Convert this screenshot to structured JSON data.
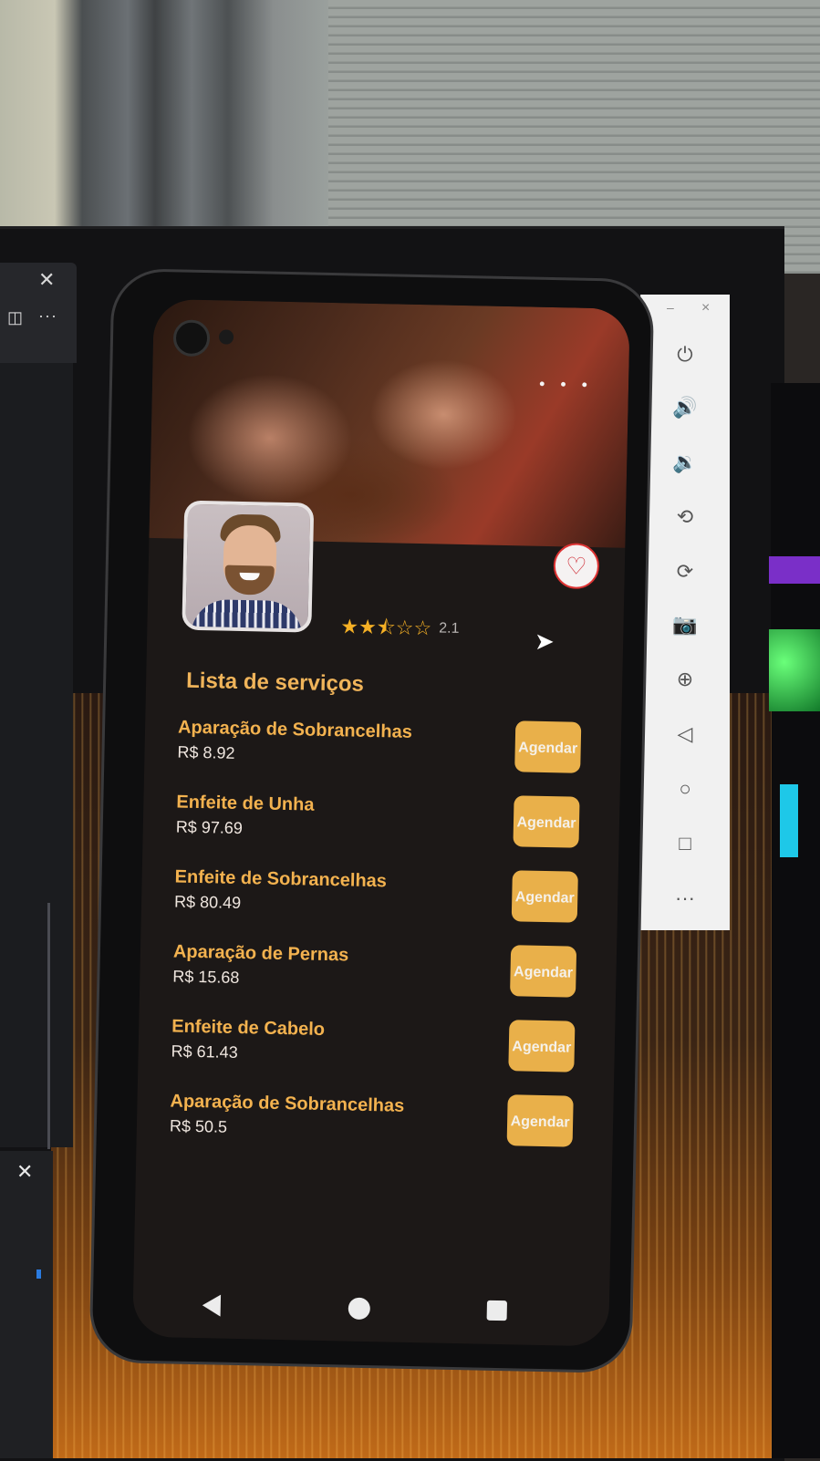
{
  "desktop": {
    "left_panel": {
      "close_icon": "✕",
      "more_icon": "···"
    },
    "left_panel_2": {
      "close_icon": "✕"
    }
  },
  "emulator_toolbar": {
    "minimize_icon": "–",
    "close_icon": "×",
    "tools": [
      {
        "name": "power-icon",
        "glyph": "⏻"
      },
      {
        "name": "volume-up-icon",
        "glyph": "🔊"
      },
      {
        "name": "volume-down-icon",
        "glyph": "🔉"
      },
      {
        "name": "rotate-left-icon",
        "glyph": "⟲"
      },
      {
        "name": "rotate-right-icon",
        "glyph": "⟳"
      },
      {
        "name": "camera-icon",
        "glyph": "📷"
      },
      {
        "name": "zoom-icon",
        "glyph": "⊕"
      },
      {
        "name": "back-icon",
        "glyph": "◁"
      },
      {
        "name": "home-icon",
        "glyph": "○"
      },
      {
        "name": "overview-icon",
        "glyph": "□"
      },
      {
        "name": "more-icon",
        "glyph": "···"
      }
    ]
  },
  "app": {
    "hero": {
      "menu_dots": "• • •"
    },
    "favorite_icon": "♡",
    "rating": {
      "value": "2.1",
      "stars_filled": 2.5,
      "stars_total": 5
    },
    "section_title": "Lista de serviços",
    "services": [
      {
        "name": "Aparação de Sobrancelhas",
        "price": "R$ 8.92",
        "button": "Agendar"
      },
      {
        "name": "Enfeite de Unha",
        "price": "R$ 97.69",
        "button": "Agendar"
      },
      {
        "name": "Enfeite de Sobrancelhas",
        "price": "R$ 80.49",
        "button": "Agendar"
      },
      {
        "name": "Aparação de Pernas",
        "price": "R$ 15.68",
        "button": "Agendar"
      },
      {
        "name": "Enfeite de Cabelo",
        "price": "R$ 61.43",
        "button": "Agendar"
      },
      {
        "name": "Aparação de Sobrancelhas",
        "price": "R$ 50.5",
        "button": "Agendar"
      }
    ]
  },
  "colors": {
    "accent": "#f3b24f",
    "button_bg": "#e9b04a",
    "screen_bg": "#1c1817",
    "star": "#f5b025",
    "heart": "#d0313a"
  }
}
